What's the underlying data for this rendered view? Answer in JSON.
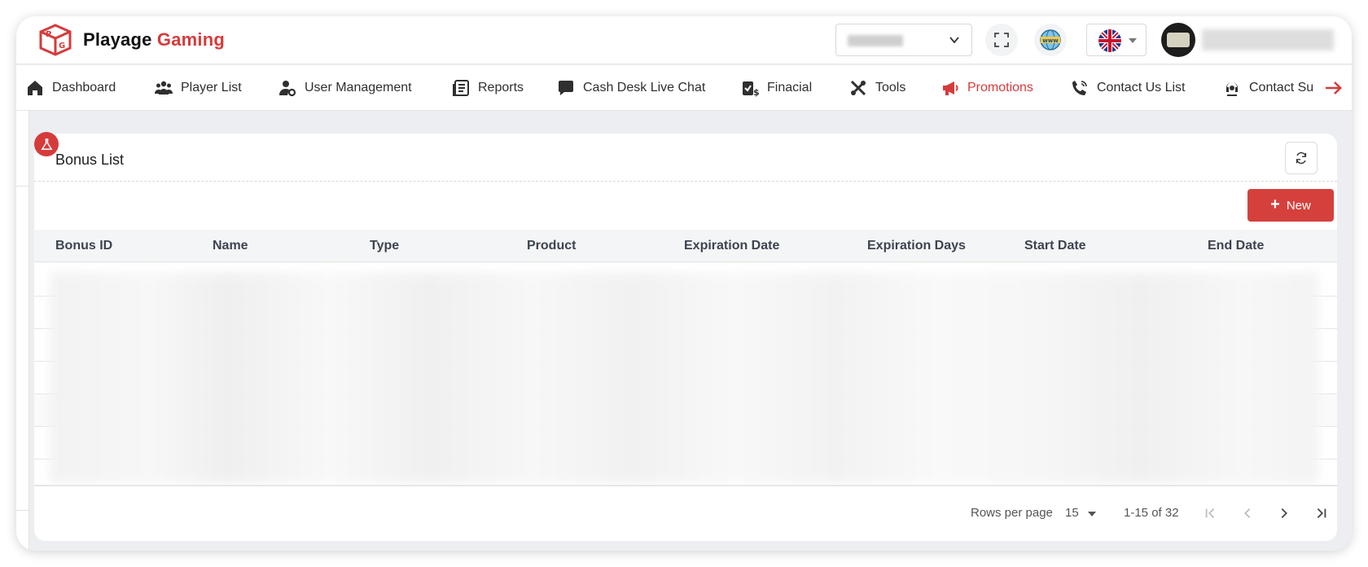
{
  "brand": {
    "name_part1": "Playage",
    "name_part2": "Gaming"
  },
  "header": {
    "site_selector": {
      "value": "Licdec"
    },
    "language": "en-GB"
  },
  "nav": {
    "items": [
      {
        "label": "Dashboard",
        "icon": "home-icon"
      },
      {
        "label": "Player List",
        "icon": "users-icon"
      },
      {
        "label": "User Management",
        "icon": "user-gear-icon"
      },
      {
        "label": "Reports",
        "icon": "reports-icon"
      },
      {
        "label": "Cash Desk Live Chat",
        "icon": "chat-icon"
      },
      {
        "label": "Finacial",
        "icon": "financial-icon"
      },
      {
        "label": "Tools",
        "icon": "tools-icon"
      },
      {
        "label": "Promotions",
        "icon": "megaphone-icon",
        "active": true
      },
      {
        "label": "Contact Us List",
        "icon": "phone-icon"
      },
      {
        "label": "Contact Su",
        "icon": "support-icon"
      }
    ]
  },
  "page": {
    "title": "Bonus List",
    "new_button": "New"
  },
  "table": {
    "columns": [
      "Bonus ID",
      "Name",
      "Type",
      "Product",
      "Expiration Date",
      "Expiration Days",
      "Start Date",
      "End Date"
    ]
  },
  "pagination": {
    "rows_per_page_label": "Rows per page",
    "rows_per_page": "15",
    "range": "1-15 of 32"
  },
  "colors": {
    "accent": "#d63b3b",
    "header_bg": "#f4f5f7"
  }
}
